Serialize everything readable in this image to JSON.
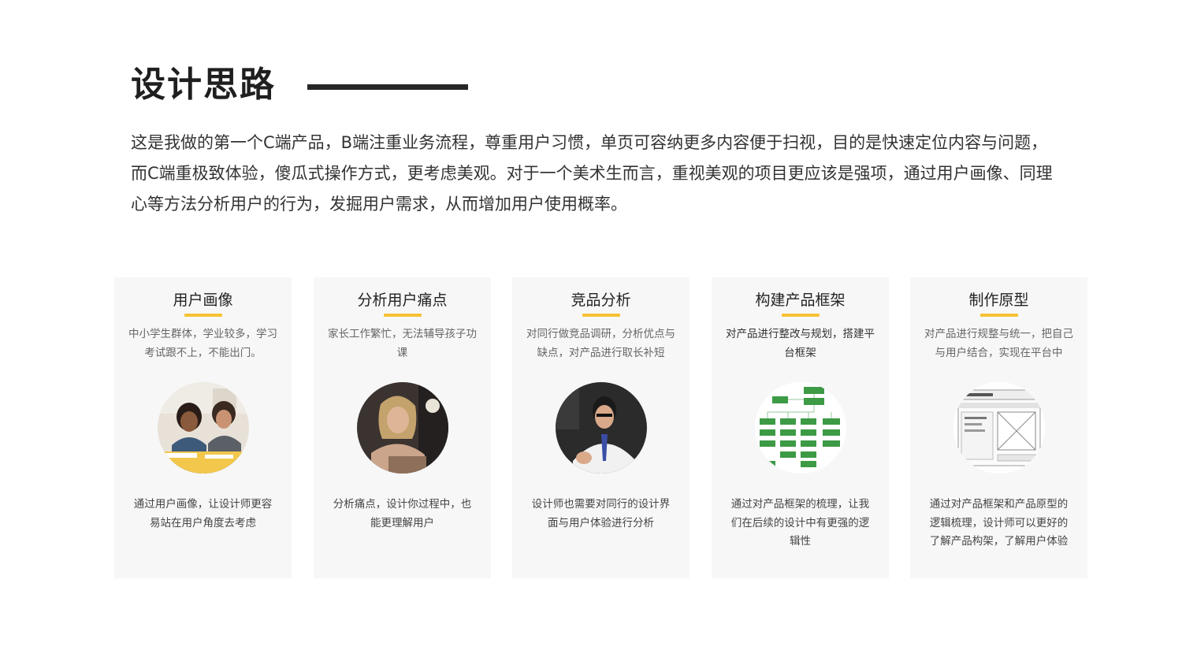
{
  "page": {
    "title": "设计思路",
    "intro": "这是我做的第一个C端产品，B端注重业务流程，尊重用户习惯，单页可容纳更多内容便于扫视，目的是快速定位内容与问题，而C端重极致体验，傻瓜式操作方式，更考虑美观。对于一个美术生而言，重视美观的项目更应该是强项，通过用户画像、同理心等方法分析用户的行为，发掘用户需求，从而增加用户使用概率。"
  },
  "accent_color": "#f6c234",
  "cards": [
    {
      "title": "用户画像",
      "desc": "中小学生群体，学业较多，学习考试跟不上，不能出门。",
      "image": "children-studying-photo",
      "foot": "通过用户画像，让设计师更容易站在用户角度去考虑"
    },
    {
      "title": "分析用户痛点",
      "desc": "家长工作繁忙，无法辅导孩子功课",
      "image": "busy-parent-photo",
      "foot": "分析痛点，设计你过程中，也能更理解用户"
    },
    {
      "title": "竞品分析",
      "desc": "对同行做竞品调研，分析优点与缺点，对产品进行取长补短",
      "image": "teacher-photo",
      "foot": "设计师也需要对同行的设计界面与用户体验进行分析"
    },
    {
      "title": "构建产品框架",
      "desc": "对产品进行整改与规划，搭建平台框架",
      "image": "framework-diagram",
      "foot": "通过对产品框架的梳理，让我们在后续的设计中有更强的逻辑性"
    },
    {
      "title": "制作原型",
      "desc": "对产品进行规整与统一，把自己与用户结合，实现在平台中",
      "image": "wireframe-prototype",
      "foot": "通过对产品框架和产品原型的逻辑梳理，设计师可以更好的了解产品构架，了解用户体验"
    }
  ]
}
